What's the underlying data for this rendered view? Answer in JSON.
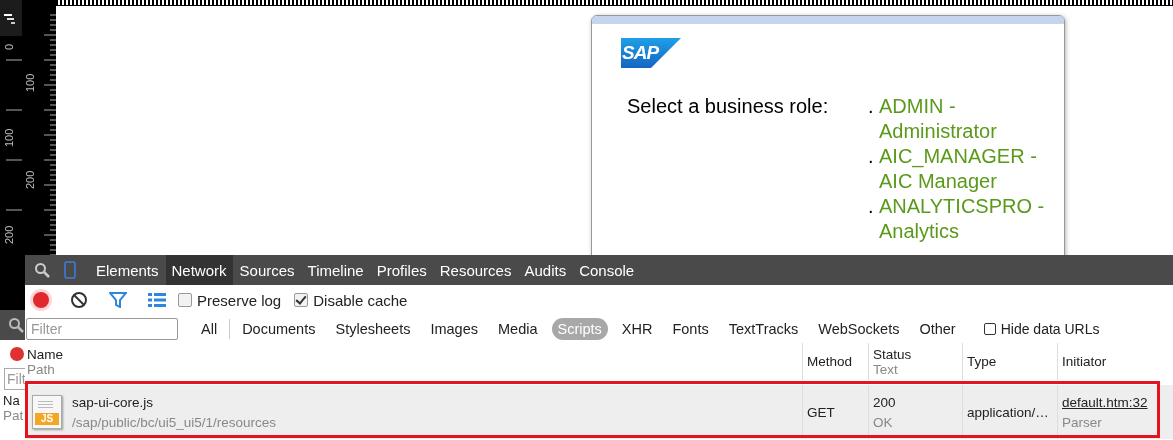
{
  "ruler": {
    "outer_labels": [
      "0",
      "100",
      "200"
    ],
    "inner_labels": [
      "100",
      "200"
    ]
  },
  "page": {
    "logo": "SAP",
    "prompt": "Select a business role:",
    "roles": [
      {
        "bullet": ".",
        "text": "ADMIN - Administrator"
      },
      {
        "bullet": ".",
        "text": "AIC_MANAGER - AIC Manager"
      },
      {
        "bullet": ".",
        "text": "ANALYTICSPRO - Analytics"
      }
    ]
  },
  "background_panel": {
    "filter_placeholder": "Filt",
    "name_header": "Na",
    "path_header": "Pat"
  },
  "devtools": {
    "tabs": [
      {
        "label": "Elements",
        "selected": false
      },
      {
        "label": "Network",
        "selected": true
      },
      {
        "label": "Sources",
        "selected": false
      },
      {
        "label": "Timeline",
        "selected": false
      },
      {
        "label": "Profiles",
        "selected": false
      },
      {
        "label": "Resources",
        "selected": false
      },
      {
        "label": "Audits",
        "selected": false
      },
      {
        "label": "Console",
        "selected": false
      }
    ],
    "toolbar": {
      "recording": true,
      "preserve_log": {
        "label": "Preserve log",
        "checked": false
      },
      "disable_cache": {
        "label": "Disable cache",
        "checked": true
      }
    },
    "filter": {
      "placeholder": "Filter"
    },
    "types": [
      {
        "label": "All",
        "selected": false
      },
      {
        "label": "Documents",
        "selected": false
      },
      {
        "label": "Stylesheets",
        "selected": false
      },
      {
        "label": "Images",
        "selected": false
      },
      {
        "label": "Media",
        "selected": false
      },
      {
        "label": "Scripts",
        "selected": true
      },
      {
        "label": "XHR",
        "selected": false
      },
      {
        "label": "Fonts",
        "selected": false
      },
      {
        "label": "TextTracks",
        "selected": false
      },
      {
        "label": "WebSockets",
        "selected": false
      },
      {
        "label": "Other",
        "selected": false
      }
    ],
    "hide_data_urls": {
      "label": "Hide data URLs",
      "checked": false
    },
    "columns": [
      {
        "title": "Name",
        "subtitle": "Path"
      },
      {
        "title": "Method"
      },
      {
        "title": "Status",
        "subtitle": "Text"
      },
      {
        "title": "Type"
      },
      {
        "title": "Initiator"
      }
    ],
    "rows": [
      {
        "file_badge": "JS",
        "name": "sap-ui-core.js",
        "path": "/sap/public/bc/ui5_ui5/1/resources",
        "method": "GET",
        "status": "200",
        "status_text": "OK",
        "type": "application/…",
        "initiator": "default.htm:32",
        "initiator_detail": "Parser",
        "highlighted": true
      }
    ]
  }
}
